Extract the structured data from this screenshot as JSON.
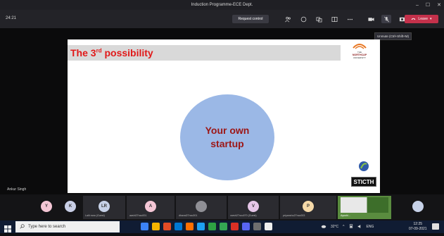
{
  "window": {
    "title": "Induction Programme-ECE Dept.",
    "minimize_glyph": "–",
    "maximize_glyph": "☐",
    "close_glyph": "✕"
  },
  "toolbar": {
    "timer": "24:21",
    "request_control": "Request control",
    "leave": "Leave",
    "icons": [
      "people-icon",
      "chat-icon",
      "reactions-icon",
      "rooms-icon",
      "more-icon",
      "camera-icon",
      "mic-off-icon",
      "share-icon"
    ],
    "tooltip": "Unmute (Ctrl+Shift+M)"
  },
  "slide": {
    "title_main": "The 3",
    "title_sup": "rd",
    "title_rest": " possibility",
    "circle_line1": "Your own",
    "circle_line2": "startup",
    "logo_text": "STICTH",
    "university_line1": "THE",
    "university_line2": "NORTHCAP",
    "university_line3": "UNIVERSITY"
  },
  "presenter": {
    "name": "Ankur Singh"
  },
  "participants": [
    {
      "initial": "Y",
      "name": "",
      "color": "#f4c6d5"
    },
    {
      "initial": "K",
      "name": "",
      "color": "#c9cfe6"
    },
    {
      "initial": "LR",
      "name": "Lalit rana (Guest)",
      "color": "#c7d2e8"
    },
    {
      "initial": "A",
      "name": "aashi27ncu001",
      "color": "#f4c6d5"
    },
    {
      "initial": "",
      "name": "dhaval27ncu001",
      "color": "#8f8f95"
    },
    {
      "initial": "V",
      "name": "varsh27ncu070 (Guest)",
      "color": "#e6c6e8"
    },
    {
      "initial": "P",
      "name": "priyanshu27ncu003",
      "color": "#f5d9a8"
    },
    {
      "initial": "",
      "name": "Ayushi...",
      "color": "#5a8c3f"
    },
    {
      "initial": "",
      "name": "",
      "color": "#c7d2e8"
    }
  ],
  "taskbar": {
    "search_placeholder": "Type here to search",
    "weather": "32°C",
    "lang": "ENG",
    "time": "12:25",
    "date": "07-09-2021",
    "app_colors": [
      "#3b82f6",
      "#f4b400",
      "#e34c26",
      "#0078d4",
      "#ff6f00",
      "#1da1f2",
      "#2ea043",
      "#34a853",
      "#d93025",
      "#5865f2",
      "#6e6e6e",
      "#eeeeee"
    ]
  },
  "colors": {
    "leave": "#c4314b",
    "slide_title": "#e11919",
    "circle_fill": "#9bb8e6",
    "circle_text": "#9c1616"
  }
}
